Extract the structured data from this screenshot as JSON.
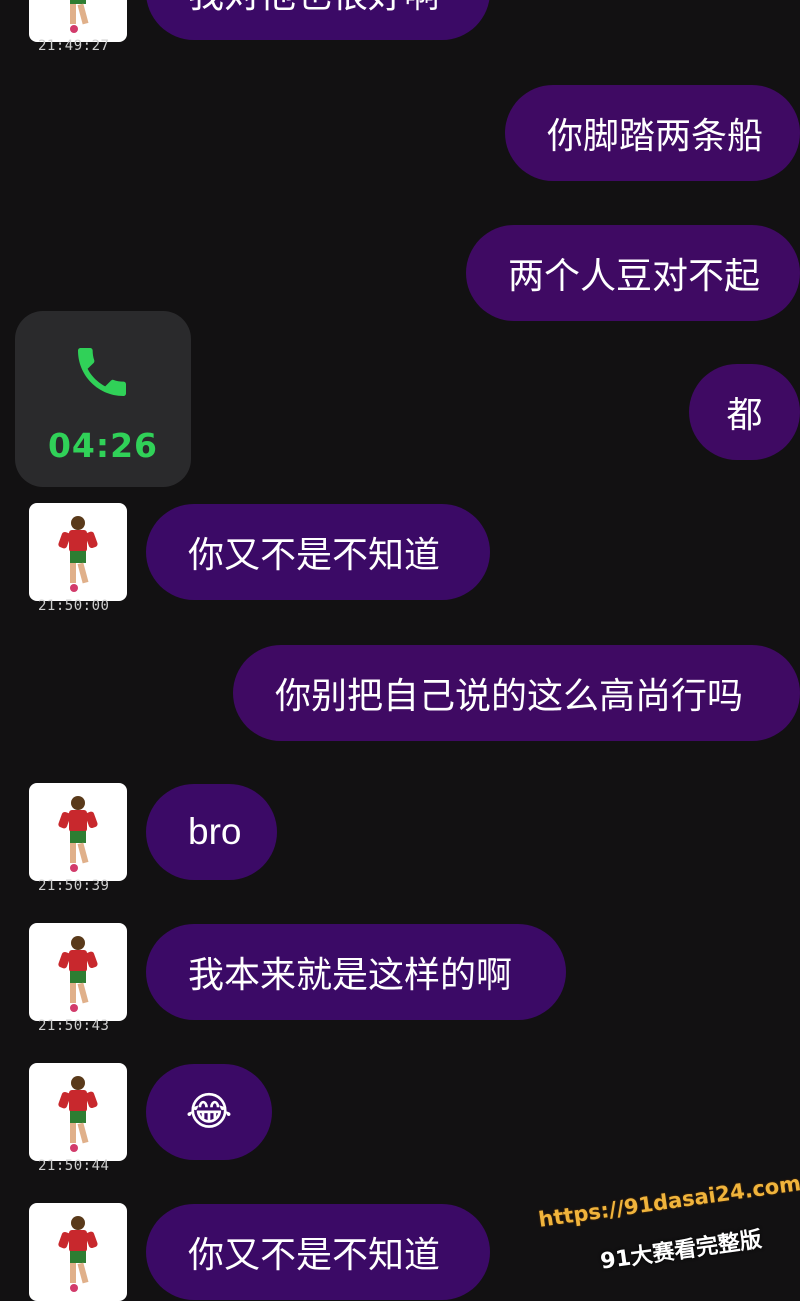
{
  "messages": [
    {
      "side": "in",
      "text": "我对他也很好啊",
      "time": "21:49:27"
    },
    {
      "side": "out",
      "text": "你脚踏两条船"
    },
    {
      "side": "out",
      "text": "两个人豆对不起"
    },
    {
      "side": "call",
      "duration": "04:26"
    },
    {
      "side": "out",
      "text": "都"
    },
    {
      "side": "in",
      "text": "你又不是不知道",
      "time": "21:50:00"
    },
    {
      "side": "out",
      "text": "你别把自己说的这么高尚行吗"
    },
    {
      "side": "in",
      "text": "bro",
      "time": "21:50:39"
    },
    {
      "side": "in",
      "text": "我本来就是这样的啊",
      "time": "21:50:43"
    },
    {
      "side": "in",
      "text": "😂",
      "time": "21:50:44"
    },
    {
      "side": "in",
      "text": "你又不是不知道"
    }
  ],
  "call": {
    "icon": "phone-icon",
    "duration": "04:26",
    "duration_color": "#30d158"
  },
  "watermark": {
    "url": "https://91dasai24.com",
    "subtitle": "91大赛看完整版"
  },
  "colors": {
    "background": "#121112",
    "bubble": "#3f0a63",
    "call_card": "#2a2a2c"
  }
}
